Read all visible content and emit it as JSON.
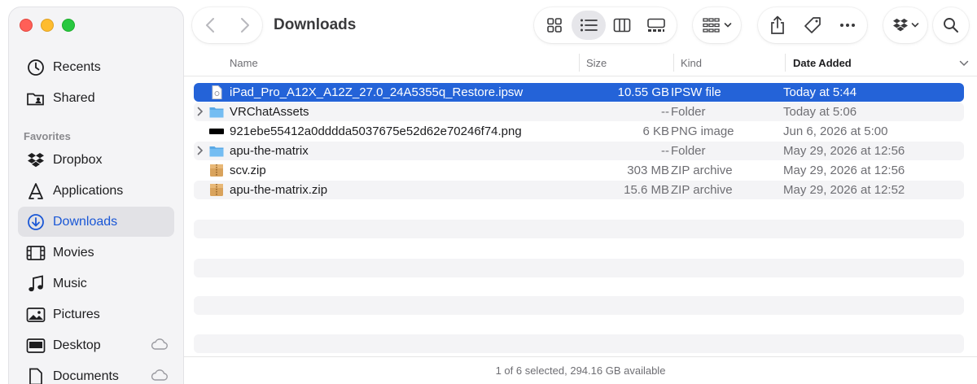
{
  "window": {
    "title": "Downloads"
  },
  "sidebar": {
    "favorites_heading": "Favorites",
    "items": [
      {
        "label": "Recents",
        "icon": "clock-icon"
      },
      {
        "label": "Shared",
        "icon": "shared-folder-icon"
      },
      {
        "label": "Dropbox",
        "icon": "dropbox-icon"
      },
      {
        "label": "Applications",
        "icon": "applications-icon"
      },
      {
        "label": "Downloads",
        "icon": "download-circle-icon",
        "active": true
      },
      {
        "label": "Movies",
        "icon": "film-icon"
      },
      {
        "label": "Music",
        "icon": "music-note-icon"
      },
      {
        "label": "Pictures",
        "icon": "photo-icon"
      },
      {
        "label": "Desktop",
        "icon": "desktop-icon"
      },
      {
        "label": "Documents",
        "icon": "document-icon"
      }
    ]
  },
  "list": {
    "columns": {
      "name": "Name",
      "size": "Size",
      "kind": "Kind",
      "date": "Date Added"
    },
    "rows": [
      {
        "name": "iPad_Pro_A12X_A12Z_27.0_24A5355q_Restore.ipsw",
        "size": "10.55 GB",
        "kind": "IPSW file",
        "date": "Today at 5:44"
      },
      {
        "name": "VRChatAssets",
        "size": "--",
        "kind": "Folder",
        "date": "Today at 5:06"
      },
      {
        "name": "921ebe55412a0dddda5037675e52d62e70246f74.png",
        "size": "6 KB",
        "kind": "PNG image",
        "date": "Jun 6, 2026 at 5:00"
      },
      {
        "name": "apu-the-matrix",
        "size": "--",
        "kind": "Folder",
        "date": "May 29, 2026 at 12:56"
      },
      {
        "name": "scv.zip",
        "size": "303 MB",
        "kind": "ZIP archive",
        "date": "May 29, 2026 at 12:56"
      },
      {
        "name": "apu-the-matrix.zip",
        "size": "15.6 MB",
        "kind": "ZIP archive",
        "date": "May 29, 2026 at 12:52"
      }
    ]
  },
  "status": {
    "text": "1 of 6 selected, 294.16 GB available"
  },
  "colors": {
    "accent": "#2463d8",
    "active_sidebar_text": "#1a57d6"
  }
}
